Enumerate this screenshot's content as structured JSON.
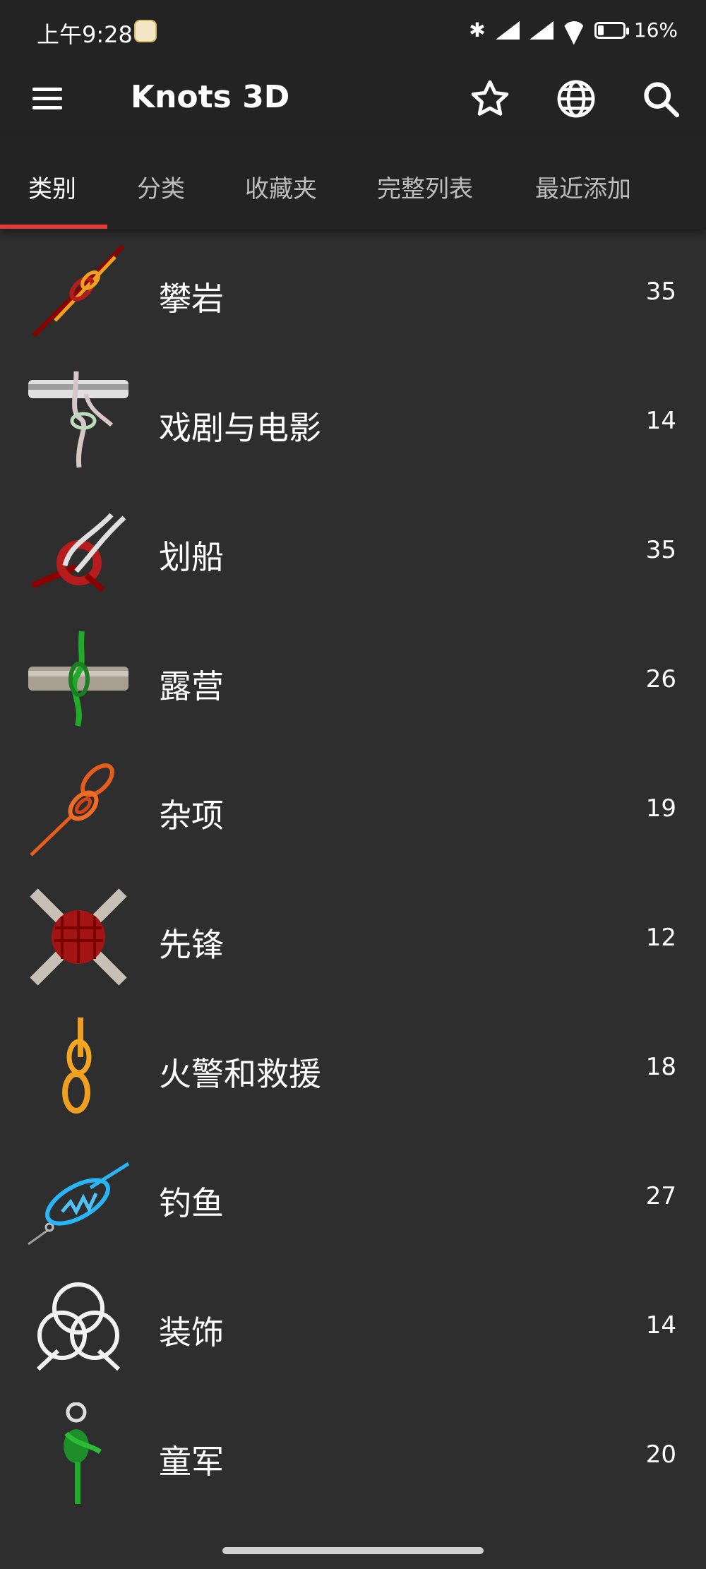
{
  "status": {
    "time": "上午9:28",
    "battery": "16%"
  },
  "app": {
    "title": "Knots 3D"
  },
  "tabs": [
    {
      "label": "类别"
    },
    {
      "label": "分类"
    },
    {
      "label": "收藏夹"
    },
    {
      "label": "完整列表"
    },
    {
      "label": "最近添加"
    }
  ],
  "categories": [
    {
      "label": "攀岩",
      "count": "35"
    },
    {
      "label": "戏剧与电影",
      "count": "14"
    },
    {
      "label": "划船",
      "count": "35"
    },
    {
      "label": "露营",
      "count": "26"
    },
    {
      "label": "杂项",
      "count": "19"
    },
    {
      "label": "先锋",
      "count": "12"
    },
    {
      "label": "火警和救援",
      "count": "18"
    },
    {
      "label": "钓鱼",
      "count": "27"
    },
    {
      "label": "装饰",
      "count": "14"
    },
    {
      "label": "童军",
      "count": "20"
    }
  ],
  "colors": {
    "background": "#2e2e2e",
    "bar": "#232323",
    "accent": "#e53935"
  }
}
